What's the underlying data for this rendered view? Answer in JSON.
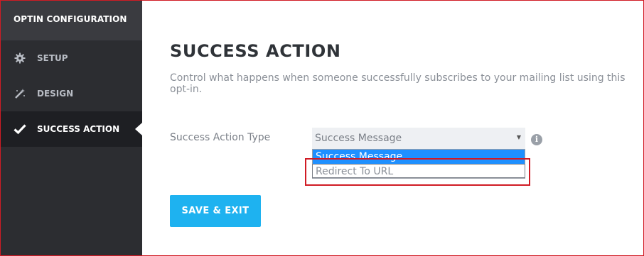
{
  "sidebar": {
    "title": "OPTIN CONFIGURATION",
    "items": [
      {
        "label": "SETUP",
        "icon": "gear-icon"
      },
      {
        "label": "DESIGN",
        "icon": "magic-wand-icon"
      },
      {
        "label": "SUCCESS ACTION",
        "icon": "checkmark-icon",
        "active": true
      }
    ]
  },
  "main": {
    "title": "SUCCESS ACTION",
    "description": "Control what happens when someone successfully subscribes to your mailing list using this opt-in.",
    "field": {
      "label": "Success Action Type",
      "selected": "Success Message",
      "options": [
        "Success Message",
        "Redirect To URL"
      ]
    },
    "save_label": "SAVE & EXIT"
  },
  "colors": {
    "accent": "#1eb2f0",
    "selected_option": "#1e90ff",
    "highlight": "#d01b24"
  }
}
